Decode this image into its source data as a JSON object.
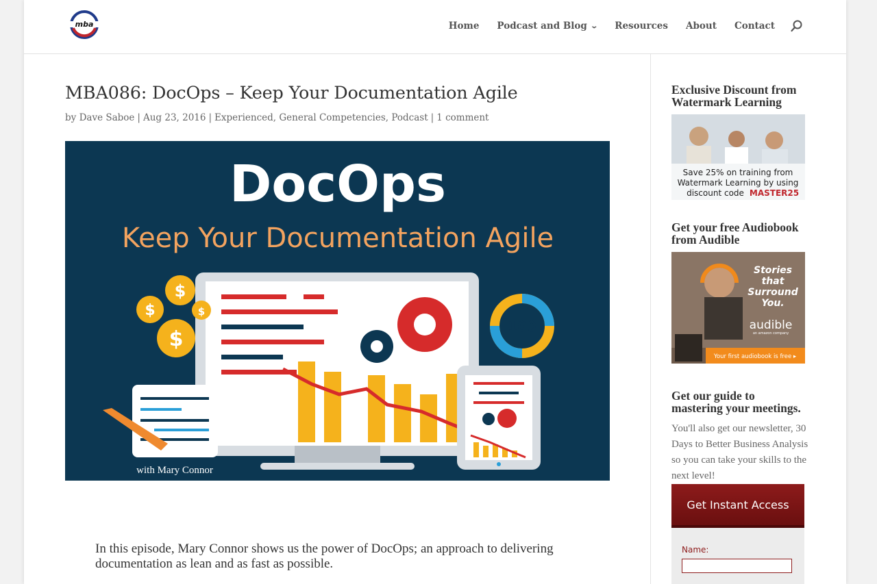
{
  "nav": {
    "items": [
      {
        "label": "Home",
        "has_dropdown": false
      },
      {
        "label": "Podcast and Blog",
        "has_dropdown": true
      },
      {
        "label": "Resources",
        "has_dropdown": false
      },
      {
        "label": "About",
        "has_dropdown": false
      },
      {
        "label": "Contact",
        "has_dropdown": false
      }
    ],
    "search_icon": "search-icon"
  },
  "post": {
    "title": "MBA086: DocOps – Keep Your Documentation Agile",
    "meta": {
      "by": "by",
      "author": "Dave Saboe",
      "date": "Aug 23, 2016",
      "categories": [
        "Experienced",
        "General Competencies",
        "Podcast"
      ],
      "comments": "1 comment"
    },
    "hero": {
      "headline": "DocOps",
      "subhead": "Keep Your Documentation Agile",
      "gauge_value": "100",
      "credit": "with Mary Connor"
    },
    "intro": "In this episode, Mary Connor shows us the power of DocOps; an approach to delivering documentation as lean and as fast as possible."
  },
  "sidebar": {
    "widget1": {
      "title": "Exclusive Discount from Watermark Learning",
      "ad_line1": "Save 25% on training from",
      "ad_line2": "Watermark Learning by using",
      "ad_line3": "discount code",
      "ad_code": "MASTER25"
    },
    "widget2": {
      "title": "Get your free Audiobook from Audible",
      "ad_tagline_1": "Stories",
      "ad_tagline_2": "that",
      "ad_tagline_3": "Surround",
      "ad_tagline_4": "You.",
      "ad_brand": "audible",
      "ad_brand_sub": "an amazon company",
      "ad_cta": "Your first audiobook is free ▸"
    },
    "widget3": {
      "title": "Get our guide to mastering your meetings.",
      "text": "You'll also get our newsletter, 30 Days to Better Business Analysis so you can take your skills to the next level!",
      "button": "Get Instant Access",
      "name_label": "Name:"
    }
  },
  "colors": {
    "hero_bg": "#0c3752",
    "hero_orange": "#f3a35f",
    "accent_red": "#8d1b1b",
    "gold": "#f5b21c"
  }
}
